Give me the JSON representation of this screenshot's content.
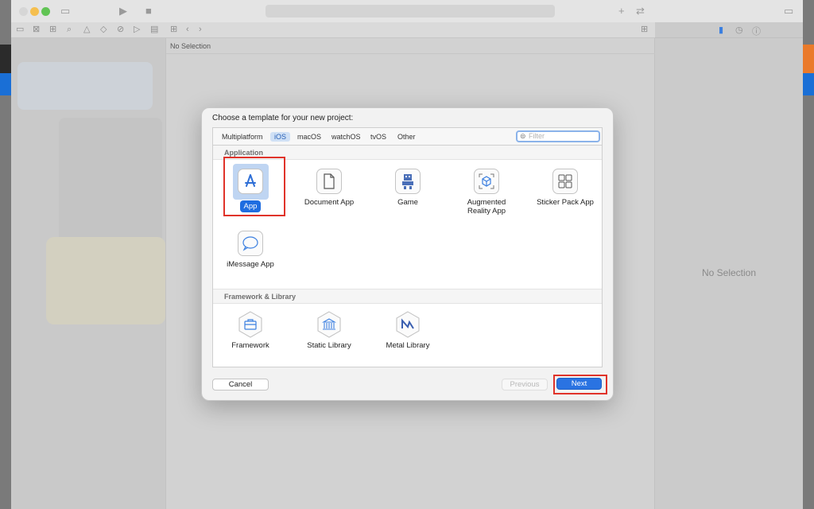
{
  "editor": {
    "jump_bar_text": "No Selection"
  },
  "inspector": {
    "no_selection": "No Selection"
  },
  "dialog": {
    "title": "Choose a template for your new project:",
    "platform_tabs": [
      "Multiplatform",
      "iOS",
      "macOS",
      "watchOS",
      "tvOS",
      "Other"
    ],
    "selected_tab": "iOS",
    "filter_placeholder": "Filter",
    "sections": [
      {
        "header": "Application",
        "templates": [
          {
            "label": "App",
            "icon": "app-store-a-icon",
            "selected": true
          },
          {
            "label": "Document App",
            "icon": "document-icon"
          },
          {
            "label": "Game",
            "icon": "game-sprite-icon"
          },
          {
            "label": "Augmented\nReality App",
            "icon": "ar-cube-icon"
          },
          {
            "label": "Sticker Pack App",
            "icon": "grid-icon"
          },
          {
            "label": "iMessage App",
            "icon": "speech-bubble-icon"
          }
        ]
      },
      {
        "header": "Framework & Library",
        "templates": [
          {
            "label": "Framework",
            "icon": "toolbox-icon"
          },
          {
            "label": "Static Library",
            "icon": "bank-building-icon"
          },
          {
            "label": "Metal Library",
            "icon": "metal-m-icon"
          }
        ]
      }
    ],
    "buttons": {
      "cancel": "Cancel",
      "previous": "Previous",
      "next": "Next"
    }
  },
  "colors": {
    "accent": "#2a73e2",
    "highlight": "#e0332a",
    "selected_tab": "#cfe0f5"
  }
}
